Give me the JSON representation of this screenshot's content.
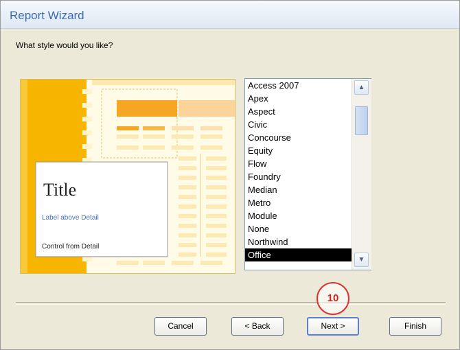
{
  "window": {
    "title": "Report Wizard"
  },
  "prompt": "What style would you like?",
  "preview": {
    "title": "Title",
    "label_text": "Label above Detail",
    "control_text": "Control from Detail"
  },
  "styles": {
    "items": [
      "Access 2007",
      "Apex",
      "Aspect",
      "Civic",
      "Concourse",
      "Equity",
      "Flow",
      "Foundry",
      "Median",
      "Metro",
      "Module",
      "None",
      "Northwind",
      "Office"
    ],
    "selected": "Office"
  },
  "buttons": {
    "cancel": "Cancel",
    "back": "< Back",
    "next": "Next >",
    "finish": "Finish"
  },
  "annotation": {
    "step": "10"
  },
  "colors": {
    "preview_orange": "#f5a800",
    "title_blue": "#3b6bb1",
    "selection": "#000000"
  }
}
